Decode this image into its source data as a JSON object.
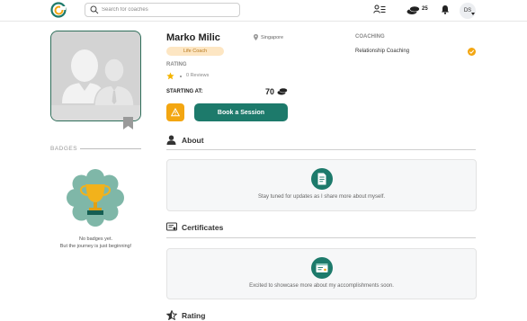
{
  "header": {
    "search_placeholder": "Search for coaches",
    "coin_count": "25",
    "avatar_initials": "DS"
  },
  "profile": {
    "name": "Marko Milic",
    "location": "Singapore",
    "tag": "Life Coach",
    "rating_label": "RATING",
    "reviews": "0 Reviews",
    "starting_label": "STARTING AT:",
    "price": "70",
    "book_label": "Book a Session",
    "coaching_label": "COACHING",
    "coaching_items": [
      "Relationship Coaching"
    ]
  },
  "badges": {
    "title": "BADGES",
    "empty_line1": "No badges yet.",
    "empty_line2": "But the journey is just beginning!"
  },
  "sections": {
    "about": {
      "title": "About",
      "text": "Stay tuned for updates as I share more about myself."
    },
    "certificates": {
      "title": "Certificates",
      "text": "Excited to showcase more about my accomplishments soon."
    },
    "rating": {
      "title": "Rating"
    }
  },
  "colors": {
    "brand_green": "#1d7a6b",
    "warning_orange": "#f3a611",
    "tag_bg": "#fde6c3",
    "star_yellow": "#f4b400"
  }
}
